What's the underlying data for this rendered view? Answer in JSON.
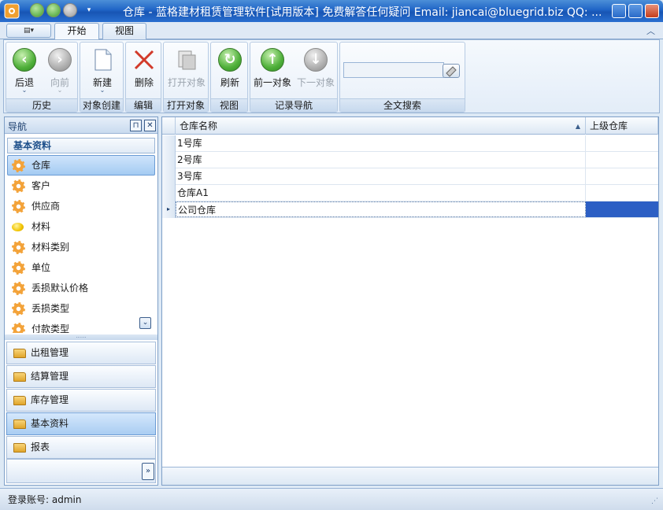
{
  "window": {
    "title": "仓库 - 蓝格建材租赁管理软件[试用版本] 免费解答任何疑问 Email: jiancai@bluegrid.biz QQ: ...",
    "min": "_",
    "max": "□",
    "close": "✕"
  },
  "qat": {
    "custom": "▾"
  },
  "tabs": {
    "menu_icon": "▤▾",
    "start": "开始",
    "view": "视图",
    "collapse": "︿"
  },
  "ribbon": {
    "history": {
      "label": "历史",
      "back": "后退",
      "forward": "向前"
    },
    "create": {
      "label": "对象创建",
      "new": "新建"
    },
    "edit": {
      "label": "编辑",
      "delete": "删除"
    },
    "open": {
      "label": "打开对象",
      "open_obj": "打开对象"
    },
    "view": {
      "label": "视图",
      "refresh": "刷新"
    },
    "records": {
      "label": "记录导航",
      "prev": "前一对象",
      "next": "下一对象"
    },
    "search": {
      "label": "全文搜索",
      "value": ""
    },
    "caret": "⌄"
  },
  "nav": {
    "title": "导航",
    "pin": "⊓",
    "close": "✕",
    "group_title": "基本资料",
    "items": [
      {
        "label": "仓库",
        "icon": "gear-icon"
      },
      {
        "label": "客户",
        "icon": "gear-icon"
      },
      {
        "label": "供应商",
        "icon": "gear-icon"
      },
      {
        "label": "材料",
        "icon": "lemon-icon"
      },
      {
        "label": "材料类别",
        "icon": "gear-icon"
      },
      {
        "label": "单位",
        "icon": "gear-icon"
      },
      {
        "label": "丢损默认价格",
        "icon": "gear-icon"
      },
      {
        "label": "丢损类型",
        "icon": "gear-icon"
      },
      {
        "label": "付款类型",
        "icon": "gear-icon"
      }
    ],
    "scroll_down": "⌄",
    "splitter": "......",
    "groups": [
      "出租管理",
      "结算管理",
      "库存管理",
      "基本资料",
      "报表"
    ],
    "more": "»"
  },
  "grid": {
    "columns": [
      "仓库名称",
      "上级仓库"
    ],
    "sort_icon": "▲",
    "rows": [
      {
        "name": "1号库",
        "parent": ""
      },
      {
        "name": "2号库",
        "parent": ""
      },
      {
        "name": "3号库",
        "parent": ""
      },
      {
        "name": "仓库A1",
        "parent": ""
      },
      {
        "name": "公司仓库",
        "parent": ""
      }
    ],
    "current_marker": "▸"
  },
  "status": {
    "text": "登录账号: admin",
    "grip": "⋰"
  },
  "colors": {
    "accent": "#2c5fc4",
    "title_bar": "#1f64c6",
    "selection": "#a4cbf2"
  }
}
